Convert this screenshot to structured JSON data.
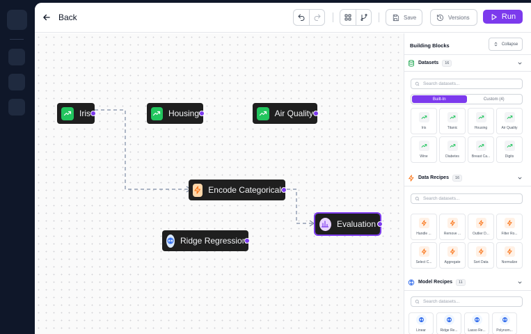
{
  "header": {
    "back_label": "Back",
    "save_label": "Save",
    "versions_label": "Versions",
    "run_label": "Run"
  },
  "canvas": {
    "nodes": [
      {
        "label": "Iris",
        "kind": "dataset",
        "icon": "trending-up-icon"
      },
      {
        "label": "Housing",
        "kind": "dataset",
        "icon": "trending-up-icon"
      },
      {
        "label": "Air Quality",
        "kind": "dataset",
        "icon": "trending-up-icon"
      },
      {
        "label": "Encode Categorical",
        "kind": "recipe",
        "icon": "zap-icon"
      },
      {
        "label": "Evaluation",
        "kind": "evaluation",
        "icon": "bar-chart-icon"
      },
      {
        "label": "Ridge Regression",
        "kind": "model",
        "icon": "model-icon"
      }
    ],
    "edges": [
      {
        "from": "Iris",
        "to": "Encode Categorical"
      },
      {
        "from": "Encode Categorical",
        "to": "Evaluation"
      }
    ]
  },
  "panel": {
    "title": "Building Blocks",
    "collapse_label": "Collapse",
    "datasets": {
      "label": "Datasets",
      "count": "16",
      "search_placeholder": "Search datasets...",
      "tab_builtin": "Built-In",
      "tab_custom": "Custom (4)",
      "items": [
        "Iris",
        "Titanic",
        "Housing",
        "Air Quality",
        "Wine",
        "Diabetes",
        "Breast Ca...",
        "Digits"
      ]
    },
    "recipes": {
      "label": "Data Recipes",
      "count": "16",
      "search_placeholder": "Search datasets...",
      "items": [
        "Handle ...",
        "Remove ...",
        "Outlier D...",
        "Filter Ro...",
        "Select C...",
        "Aggregate",
        "Sort Data",
        "Normalize"
      ]
    },
    "models": {
      "label": "Model Recipes",
      "count": "11",
      "search_placeholder": "Search datasets...",
      "items": [
        "Linear",
        "Ridge Re...",
        "Lasso Re...",
        "Polynom..."
      ]
    }
  },
  "colors": {
    "accent": "#7c3aed",
    "dataset": "#22c55e",
    "recipe": "#f97316",
    "model": "#2563eb",
    "node_bg": "#1f1f1f"
  }
}
